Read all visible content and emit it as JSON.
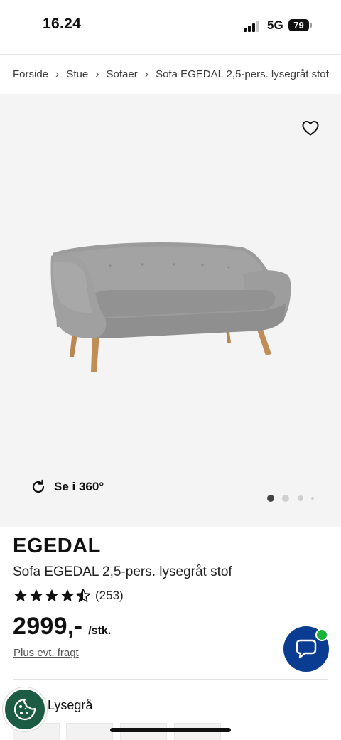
{
  "status_bar": {
    "time": "16.24",
    "network": "5G",
    "battery": "79"
  },
  "breadcrumb": [
    {
      "label": "Forside"
    },
    {
      "label": "Stue"
    },
    {
      "label": "Sofaer"
    },
    {
      "label": "Sofa EGEDAL 2,5-pers. lysegråt stof"
    }
  ],
  "gallery": {
    "rotate_label": "Se i 360°",
    "image_count": 4,
    "active_image": 1,
    "background_color": "#f4f4f4"
  },
  "product": {
    "brand": "EGEDAL",
    "name": "Sofa EGEDAL 2,5-pers. lysegråt stof",
    "rating": 4.5,
    "rating_max": 5,
    "review_count": "(253)",
    "price": "2999,-",
    "price_unit": "/stk.",
    "freight_note": "Plus evt. fragt",
    "color_label": ":",
    "color_value": "Lysegrå"
  },
  "colors": {
    "chat_button": "#0a3d91",
    "chat_online": "#17b33a",
    "cookie_button": "#1d5c44"
  },
  "icons": {
    "favorite": "heart-icon",
    "rotate": "rotate-360-icon",
    "chat": "chat-bubble-icon",
    "cookie": "cookie-icon",
    "star": "star-icon"
  }
}
